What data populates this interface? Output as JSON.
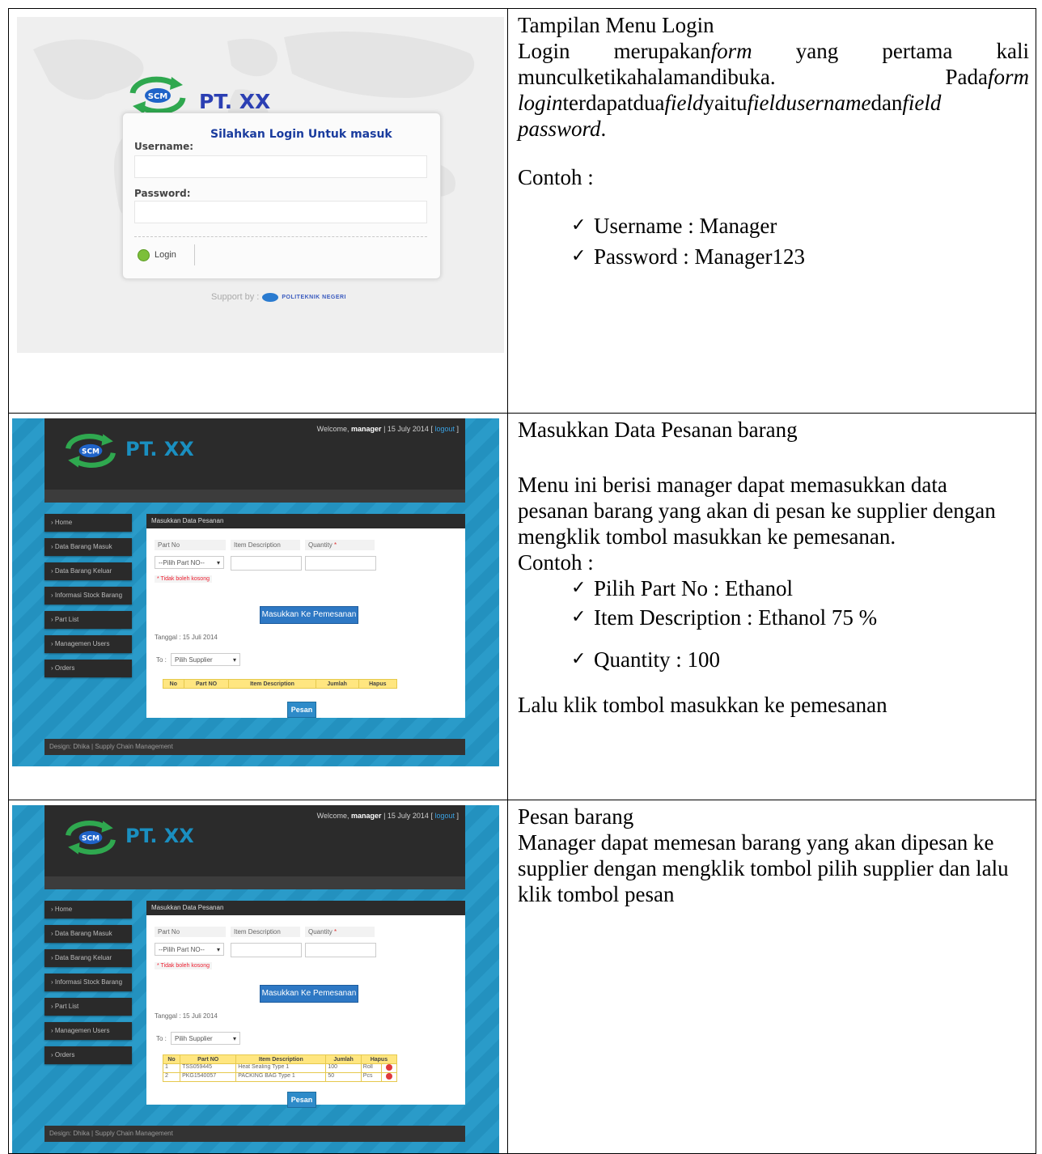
{
  "row1": {
    "login": {
      "company": "PT. XX",
      "logo_text": "SCM",
      "heading": "Silahkan Login Untuk masuk",
      "username_label": "Username:",
      "password_label": "Password:",
      "login_button": "Login",
      "support": "Support by :",
      "sponsor": "POLITEKNIK NEGERI"
    },
    "title": "Tampilan Menu Login",
    "d1": "Login merupakan",
    "d2": "form",
    "d3": " yang pertama kali munculketikahalamandibuka. Pada",
    "d4": "form login",
    "d5": "terdapatdua",
    "d6": "field",
    "d7": "yaitu",
    "d8": "fieldusername",
    "d9": "dan",
    "d10": "field password",
    "d11": ".",
    "contoh": "Contoh :",
    "items": [
      "Username : Manager",
      "Password  : Manager123"
    ]
  },
  "app": {
    "company": "PT. XX",
    "logo_text": "SCM",
    "welcome_prefix": "Welcome, ",
    "welcome_user": "manager",
    "welcome_date": " | 15 July 2014 [ ",
    "logout": "logout",
    "welcome_end": " ]",
    "menu": [
      "› Home",
      "› Data Barang Masuk",
      "› Data Barang Keluar",
      "› Informasi Stock Barang",
      "› Part List",
      "› Managemen Users",
      "› Orders"
    ],
    "panel_title": "Masukkan Data Pesanan",
    "part_no_label": "Part No",
    "item_desc_label": "Item Description",
    "quantity_label": "Quantity ",
    "required": "*",
    "part_select": "--Pilih Part NO--",
    "error": "* Tidak boleh kosong",
    "insert_button": "Masukkan Ke Pemesanan",
    "tanggal": "Tanggal : 15 Juli 2014",
    "to_label": "To :",
    "supplier_select": "Pilih Supplier",
    "columns": [
      "No",
      "Part NO",
      "Item Description",
      "Jumlah",
      "Hapus"
    ],
    "pesan_button": "Pesan",
    "footer": "Design: Dhika | Supply Chain Management"
  },
  "row2": {
    "title": "Masukkan Data Pesanan  barang",
    "desc": "Menu ini berisi manager dapat memasukkan data pesanan barang yang akan di pesan ke supplier dengan mengklik tombol masukkan ke pemesanan.",
    "contoh": "Contoh :",
    "items": [
      "Pilih Part No : Ethanol",
      "Item Description : Ethanol 75 %",
      "Quantity : 100"
    ],
    "closing": "Lalu klik tombol masukkan ke pemesanan"
  },
  "row3": {
    "title": "Pesan barang",
    "desc": "Manager dapat memesan barang yang akan dipesan ke supplier dengan mengklik tombol pilih supplier dan lalu klik tombol pesan",
    "rows": [
      [
        "1",
        "TSS059445",
        "Heat Sealing Type 1",
        "100",
        "Roll"
      ],
      [
        "2",
        "PKG1540057",
        "PACKING BAG Type 1",
        "50",
        "Pcs"
      ]
    ]
  }
}
